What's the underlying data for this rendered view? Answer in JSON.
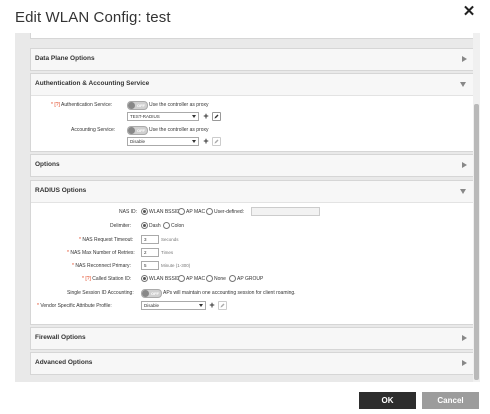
{
  "dialog": {
    "title": "Edit WLAN Config: test",
    "ok_label": "OK",
    "cancel_label": "Cancel"
  },
  "sections": {
    "data_plane": "Data Plane Options",
    "auth_acct": "Authentication & Accounting Service",
    "options": "Options",
    "radius": "RADIUS Options",
    "firewall": "Firewall Options",
    "advanced": "Advanced Options"
  },
  "auth": {
    "auth_service_req": "*",
    "auth_service_q": "[?]",
    "auth_service_label": "Authentication Service:",
    "auth_toggle": "OFF",
    "auth_proxy_text": "Use the controller as proxy",
    "auth_select": "TEST-RADIUS",
    "acct_service_label": "Accounting Service:",
    "acct_toggle": "OFF",
    "acct_proxy_text": "Use the controller as proxy",
    "acct_select": "Disable"
  },
  "radius": {
    "nas_id_label": "NAS ID:",
    "nas_opt_bssid": "WLAN BSSID",
    "nas_opt_apmac": "AP MAC",
    "nas_opt_user": "User-defined:",
    "delimiter_label": "Delimiter:",
    "delim_dash": "Dash",
    "delim_colon": "Colon",
    "req_timeout_req": "*",
    "req_timeout_label": "NAS Request Timeout:",
    "req_timeout_value": "3",
    "req_timeout_unit": "Seconds",
    "max_retries_req": "*",
    "max_retries_label": "NAS Max Number of Retries:",
    "max_retries_value": "2",
    "max_retries_unit": "Times",
    "reconnect_req": "*",
    "reconnect_label": "NAS Reconnect Primary:",
    "reconnect_value": "5",
    "reconnect_unit": "Minute (1-300)",
    "called_req": "*",
    "called_q": "[?]",
    "called_label": "Called Station ID:",
    "called_bssid": "WLAN BSSID",
    "called_apmac": "AP MAC",
    "called_none": "None",
    "called_apgroup": "AP GROUP",
    "single_session_label": "Single Session ID Accounting:",
    "single_session_toggle": "OFF",
    "single_session_text": "APs will maintain one accounting session for client roaming.",
    "vsa_req": "*",
    "vsa_label": "Vendor Specific Attribute Profile:",
    "vsa_select": "Disable"
  }
}
